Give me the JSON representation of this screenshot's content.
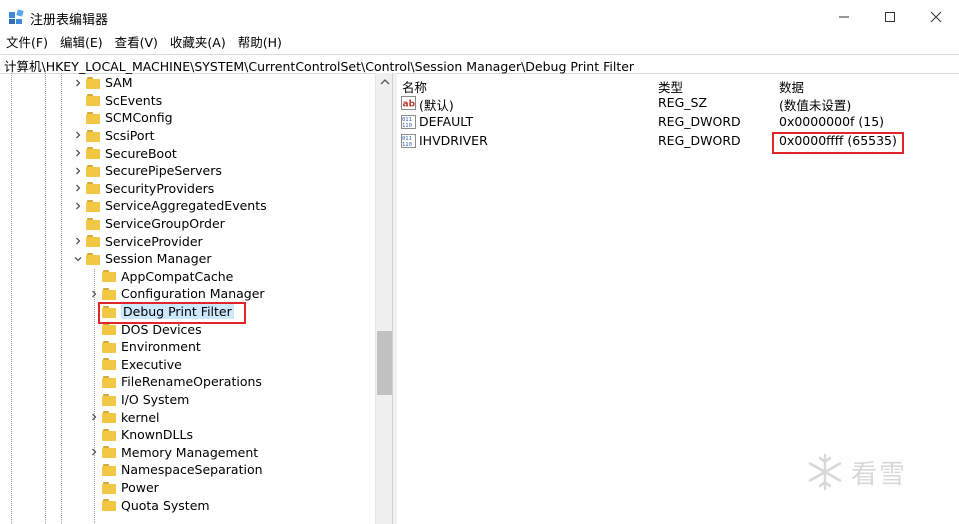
{
  "window": {
    "title": "注册表编辑器",
    "controls": [
      "minimize-icon",
      "maximize-icon",
      "close-icon"
    ]
  },
  "menu": [
    "文件(F)",
    "编辑(E)",
    "查看(V)",
    "收藏夹(A)",
    "帮助(H)"
  ],
  "address": "计算机\\HKEY_LOCAL_MACHINE\\SYSTEM\\CurrentControlSet\\Control\\Session Manager\\Debug Print Filter",
  "tree": [
    {
      "label": "SAM",
      "expander": "collapsed"
    },
    {
      "label": "ScEvents",
      "expander": "none"
    },
    {
      "label": "SCMConfig",
      "expander": "none"
    },
    {
      "label": "ScsiPort",
      "expander": "collapsed"
    },
    {
      "label": "SecureBoot",
      "expander": "collapsed"
    },
    {
      "label": "SecurePipeServers",
      "expander": "collapsed"
    },
    {
      "label": "SecurityProviders",
      "expander": "collapsed"
    },
    {
      "label": "ServiceAggregatedEvents",
      "expander": "collapsed"
    },
    {
      "label": "ServiceGroupOrder",
      "expander": "none"
    },
    {
      "label": "ServiceProvider",
      "expander": "collapsed"
    },
    {
      "label": "Session Manager",
      "expander": "expanded"
    },
    {
      "label": "AppCompatCache",
      "expander": "none"
    },
    {
      "label": "Configuration Manager",
      "expander": "collapsed"
    },
    {
      "label": "Debug Print Filter",
      "expander": "none",
      "selected": true
    },
    {
      "label": "DOS Devices",
      "expander": "none"
    },
    {
      "label": "Environment",
      "expander": "none"
    },
    {
      "label": "Executive",
      "expander": "none"
    },
    {
      "label": "FileRenameOperations",
      "expander": "none"
    },
    {
      "label": "I/O System",
      "expander": "none"
    },
    {
      "label": "kernel",
      "expander": "collapsed"
    },
    {
      "label": "KnownDLLs",
      "expander": "none"
    },
    {
      "label": "Memory Management",
      "expander": "collapsed"
    },
    {
      "label": "NamespaceSeparation",
      "expander": "none"
    },
    {
      "label": "Power",
      "expander": "none"
    },
    {
      "label": "Quota System",
      "expander": "none"
    }
  ],
  "list": {
    "headers": {
      "name": "名称",
      "type": "类型",
      "data": "数据"
    },
    "rows": [
      {
        "icon": "string-value-icon",
        "name": "(默认)",
        "type": "REG_SZ",
        "data": "(数值未设置)"
      },
      {
        "icon": "binary-value-icon",
        "name": "DEFAULT",
        "type": "REG_DWORD",
        "data": "0x0000000f (15)"
      },
      {
        "icon": "binary-value-icon",
        "name": "IHVDRIVER",
        "type": "REG_DWORD",
        "data": "0x0000ffff (65535)",
        "highlighted": true
      }
    ]
  },
  "watermark": {
    "text": "看雪",
    "icon": "snowflake-icon"
  },
  "colors": {
    "highlight_box": "#e0262a",
    "selection": "#cce8ff",
    "folder": "#f2c744"
  }
}
